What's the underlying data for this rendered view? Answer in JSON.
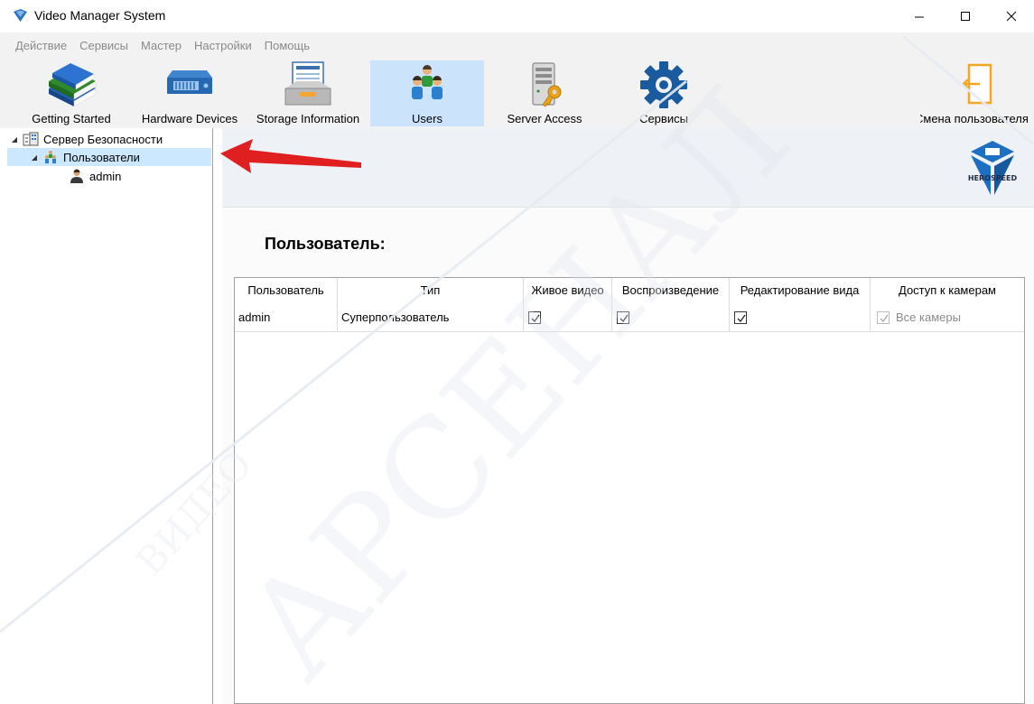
{
  "window": {
    "title": "Video Manager System"
  },
  "menubar": {
    "items": [
      "Действие",
      "Сервисы",
      "Мастер",
      "Настройки",
      "Помощь"
    ]
  },
  "toolbar": {
    "items": [
      {
        "label": "Getting Started",
        "icon": "books-icon"
      },
      {
        "label": "Hardware Devices",
        "icon": "nvr-device-icon"
      },
      {
        "label": "Storage Information",
        "icon": "storage-tray-icon"
      },
      {
        "label": "Users",
        "icon": "users-icon",
        "active": true
      },
      {
        "label": "Server Access",
        "icon": "server-key-icon"
      },
      {
        "label": "Сервисы",
        "icon": "gear-icon"
      },
      {
        "label": "Смена пользователя",
        "icon": "exit-door-icon"
      }
    ]
  },
  "tree": {
    "root": "Сервер Безопасности",
    "group": "Пользователи",
    "user": "admin"
  },
  "content": {
    "logo_text": "HEROSPEED",
    "section_title": "Пользователь:",
    "table": {
      "columns": [
        "Пользователь",
        "Тип",
        "Живое видео",
        "Воспроизведение",
        "Редактирование вида",
        "Доступ к камерам"
      ],
      "rows": [
        {
          "user": "admin",
          "type": "Суперпользователь",
          "live": true,
          "playback": true,
          "edit_view": true,
          "camera_access": "Все камеры"
        }
      ]
    }
  },
  "watermark": {
    "text_large": "АРСЕНАЛ",
    "text_small": "ВИДЕО"
  },
  "colors": {
    "selection": "#cce4fb",
    "tree_selection": "#cce8ff",
    "accent_blue": "#1b74c5",
    "arrow_red": "#e02020",
    "exit_orange": "#f5a623"
  }
}
